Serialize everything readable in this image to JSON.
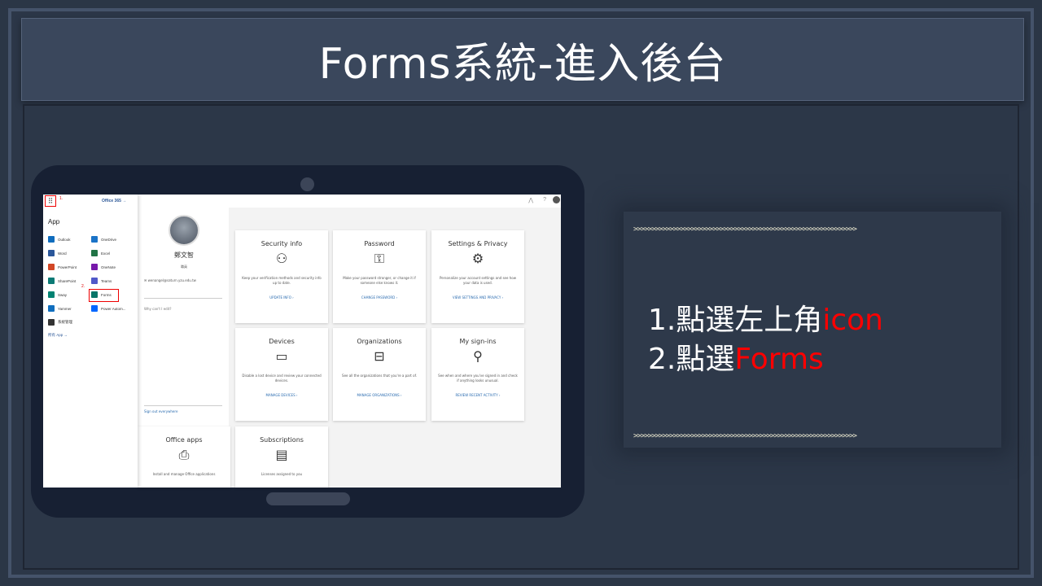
{
  "slide": {
    "title": "Forms系統-進入後台",
    "arrows_top": ">>>>>>>>>>>>>>>>>>>>>>>>>>>>>>>>>>>>>>>>>>>>>>>>>>>>>>>>>>>>>>",
    "arrows_bottom": ">>>>>>>>>>>>>>>>>>>>>>>>>>>>>>>>>>>>>>>>>>>>>>>>>>>>>>>>>>>>>>",
    "step1_prefix": "1.點選左上角",
    "step1_highlight": "icon",
    "step2_prefix": "2.點選",
    "step2_highlight": "Forms",
    "highlight_color": "#ff0000"
  },
  "screenshot": {
    "launcher": {
      "mark1": "1.",
      "mark2": "2.",
      "office365": "Office 365  →",
      "app_heading": "App",
      "apps": [
        {
          "name": "Outlook",
          "color": "#0f6cbd",
          "icon": "outlook-icon"
        },
        {
          "name": "OneDrive",
          "color": "#1a73c7",
          "icon": "onedrive-icon"
        },
        {
          "name": "Word",
          "color": "#2b579a",
          "icon": "word-icon"
        },
        {
          "name": "Excel",
          "color": "#217346",
          "icon": "excel-icon"
        },
        {
          "name": "PowerPoint",
          "color": "#d24726",
          "icon": "powerpoint-icon"
        },
        {
          "name": "OneNote",
          "color": "#7719aa",
          "icon": "onenote-icon"
        },
        {
          "name": "SharePoint",
          "color": "#0b7a75",
          "icon": "sharepoint-icon"
        },
        {
          "name": "Teams",
          "color": "#5059c9",
          "icon": "teams-icon"
        },
        {
          "name": "Sway",
          "color": "#008272",
          "icon": "sway-icon"
        },
        {
          "name": "Forms",
          "color": "#077568",
          "icon": "forms-icon"
        },
        {
          "name": "Yammer",
          "color": "#106ebe",
          "icon": "yammer-icon"
        },
        {
          "name": "Power Autom...",
          "color": "#0066ff",
          "icon": "power-automate-icon"
        },
        {
          "name": "系統管理",
          "color": "#333333",
          "icon": "admin-icon"
        }
      ],
      "all_apps": "所有 App  →"
    },
    "profile": {
      "name": "鄭文智",
      "role": "職員",
      "email": "wenangel@saturn.yzu.edu.tw",
      "why_edit": "Why can't I edit?",
      "sign_out": "Sign out everywhere"
    },
    "cards": [
      {
        "title": "Security info",
        "icon": "person-edit-icon",
        "glyph": "⚇",
        "desc": "Keep your verification methods and security info up to date.",
        "link": "UPDATE INFO  ›"
      },
      {
        "title": "Password",
        "icon": "key-icon",
        "glyph": "⚿",
        "desc": "Make your password stronger, or change it if someone else knows it.",
        "link": "CHANGE PASSWORD  ›"
      },
      {
        "title": "Settings & Privacy",
        "icon": "gear-icon",
        "glyph": "⚙",
        "desc": "Personalize your account settings and see how your data is used.",
        "link": "VIEW SETTINGS AND PRIVACY  ›"
      },
      {
        "title": "Devices",
        "icon": "laptop-icon",
        "glyph": "▭",
        "desc": "Disable a lost device and review your connected devices.",
        "link": "MANAGE DEVICES  ›"
      },
      {
        "title": "Organizations",
        "icon": "briefcase-icon",
        "glyph": "⊟",
        "desc": "See all the organizations that you're a part of.",
        "link": "MANAGE ORGANIZATIONS  ›"
      },
      {
        "title": "My sign-ins",
        "icon": "person-key-icon",
        "glyph": "⚲",
        "desc": "See when and where you've signed in and check if anything looks unusual.",
        "link": "REVIEW RECENT ACTIVITY  ›"
      },
      {
        "title": "Office apps",
        "icon": "install-icon",
        "glyph": "⎙",
        "desc": "Install and manage Office applications",
        "link": ""
      },
      {
        "title": "Subscriptions",
        "icon": "card-icon",
        "glyph": "▤",
        "desc": "Licenses assigned to you",
        "link": ""
      }
    ]
  }
}
